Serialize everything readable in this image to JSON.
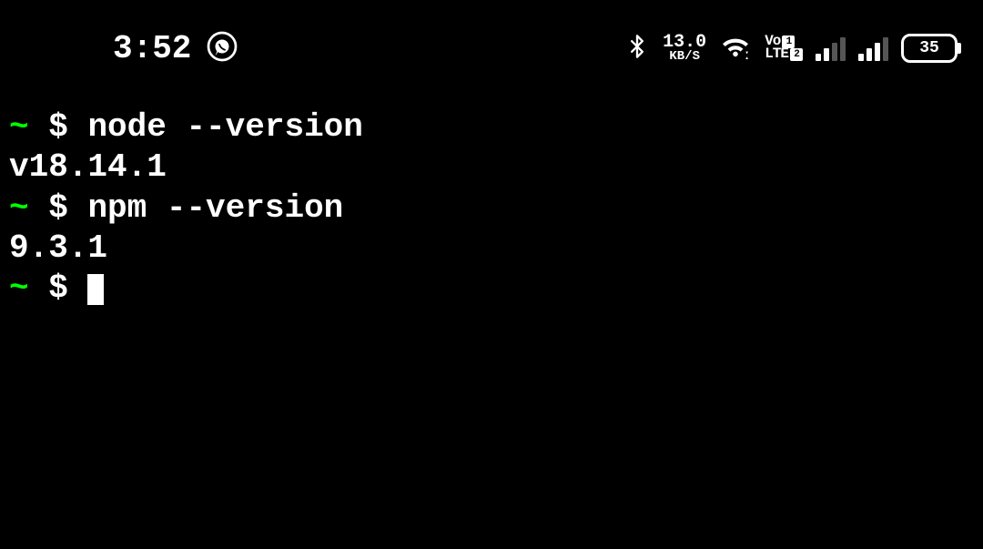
{
  "status_bar": {
    "time": "3:52",
    "net_speed_value": "13.0",
    "net_speed_unit": "KB/S",
    "volte_top": "Vo",
    "volte_top_num": "1",
    "volte_bot": "LTE",
    "volte_bot_num": "2",
    "battery_level": "35"
  },
  "terminal": {
    "lines": [
      {
        "type": "prompt",
        "cwd": "~",
        "sep": "$",
        "cmd": "node --version"
      },
      {
        "type": "output",
        "text": "v18.14.1"
      },
      {
        "type": "prompt",
        "cwd": "~",
        "sep": "$",
        "cmd": "npm --version"
      },
      {
        "type": "output",
        "text": "9.3.1"
      },
      {
        "type": "prompt",
        "cwd": "~",
        "sep": "$",
        "cmd": "",
        "cursor": true
      }
    ]
  }
}
